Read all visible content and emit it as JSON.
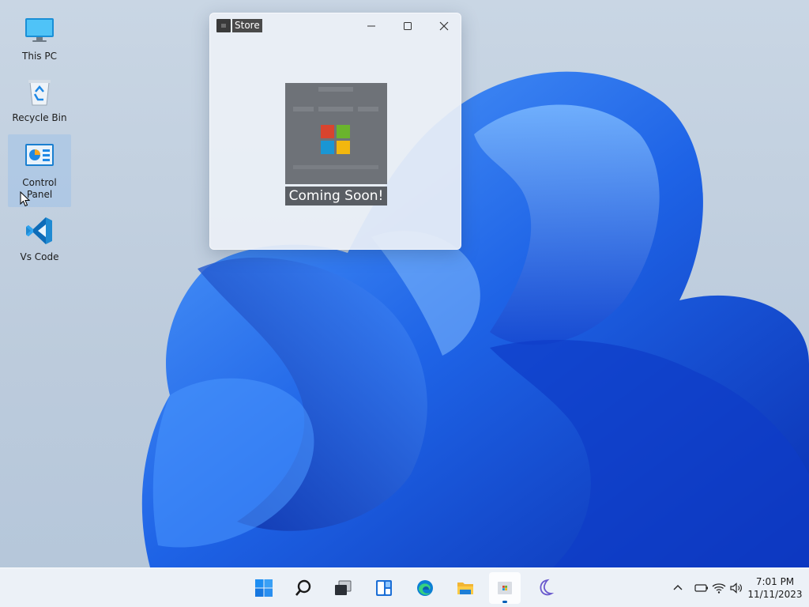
{
  "desktop": {
    "icons": [
      {
        "label": "This PC",
        "icon": "monitor-icon"
      },
      {
        "label": "Recycle Bin",
        "icon": "recycle-bin-icon"
      },
      {
        "label": "Control Panel",
        "icon": "control-panel-icon"
      },
      {
        "label": "Vs Code",
        "icon": "vscode-icon"
      }
    ]
  },
  "store_window": {
    "title": "Store",
    "message": "Coming Soon!",
    "controls": [
      "minimize-icon",
      "maximize-icon",
      "close-icon"
    ]
  },
  "taskbar": {
    "apps": [
      "start-icon",
      "search-icon",
      "task-view-icon",
      "widgets-icon",
      "edge-icon",
      "file-explorer-icon",
      "store-icon",
      "night-mode-icon"
    ],
    "active_app": "store-icon",
    "tray": [
      "chevron-up-icon",
      "battery-icon",
      "wifi-icon",
      "speaker-icon"
    ],
    "time": "7:01 PM",
    "date": "11/11/2023"
  },
  "colors": {
    "accent": "#005fb8",
    "wallpaper_blue": "#1f5fe0",
    "wallpaper_bg": "#c3d1e1"
  }
}
